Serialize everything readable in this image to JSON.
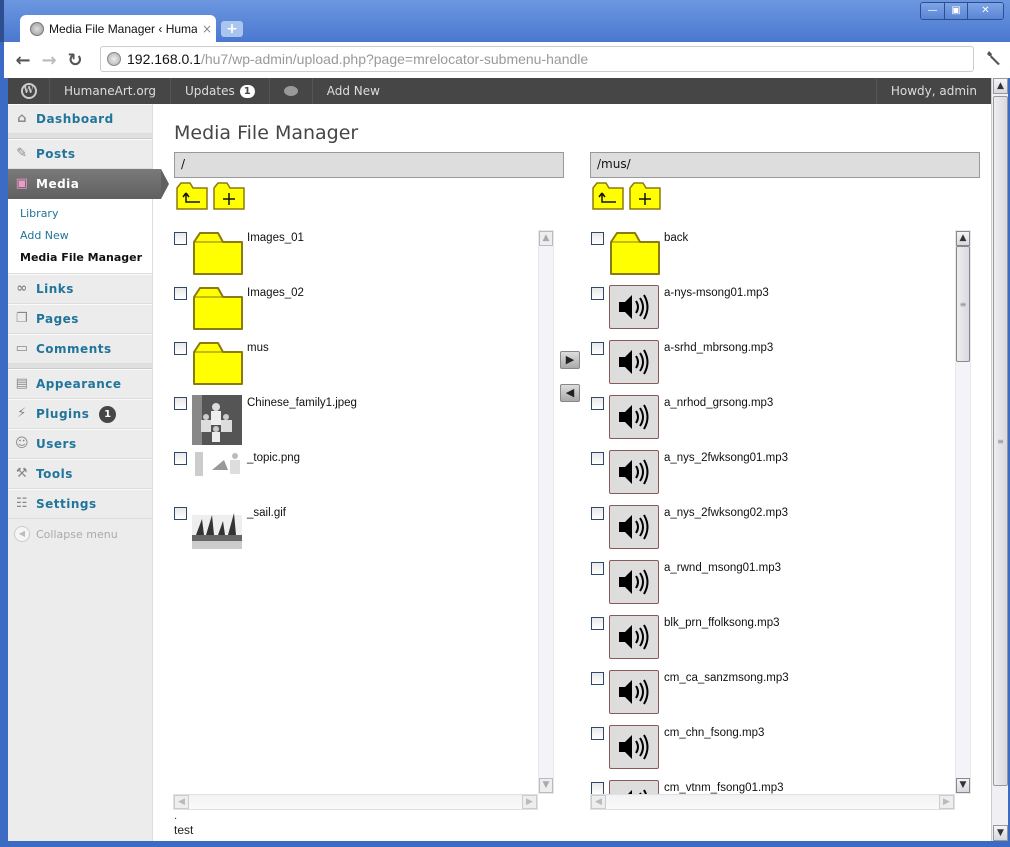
{
  "browser": {
    "tab_title": "Media File Manager ‹ Humai",
    "tab_close": "×",
    "new_tab": "+",
    "url_host": "192.168.0.1",
    "url_path": "/hu7/wp-admin/upload.php?page=mrelocator-submenu-handle",
    "window_buttons": {
      "minimize": "—",
      "maximize": "▣",
      "close": "✕"
    },
    "nav": {
      "back": "←",
      "forward": "→",
      "reload": "↻"
    },
    "wrench": "🔧"
  },
  "admin_bar": {
    "site_name": "HumaneArt.org",
    "updates_label": "Updates",
    "updates_count": "1",
    "add_new": "Add New",
    "howdy": "Howdy, admin"
  },
  "sidebar": {
    "items": [
      {
        "label": "Dashboard",
        "icon": "⌂"
      },
      {
        "label": "Posts",
        "icon": "✎"
      },
      {
        "label": "Media",
        "icon": "▣"
      },
      {
        "label": "Links",
        "icon": "∞"
      },
      {
        "label": "Pages",
        "icon": "❐"
      },
      {
        "label": "Comments",
        "icon": "▭"
      },
      {
        "label": "Appearance",
        "icon": "▤"
      },
      {
        "label": "Plugins",
        "icon": "⚡",
        "badge": "1"
      },
      {
        "label": "Users",
        "icon": "☺"
      },
      {
        "label": "Tools",
        "icon": "⚒"
      },
      {
        "label": "Settings",
        "icon": "☷"
      }
    ],
    "media_submenu": [
      "Library",
      "Add New",
      "Media File Manager"
    ],
    "collapse": "Collapse menu"
  },
  "main": {
    "title": "Media File Manager",
    "left": {
      "path": "/",
      "items": [
        {
          "name": "Images_01",
          "type": "folder"
        },
        {
          "name": "Images_02",
          "type": "folder"
        },
        {
          "name": "mus",
          "type": "folder"
        },
        {
          "name": "Chinese_family1.jpeg",
          "type": "photo"
        },
        {
          "name": "_topic.png",
          "type": "photo-light"
        },
        {
          "name": "_sail.gif",
          "type": "photo-sail"
        }
      ]
    },
    "right": {
      "path": "/mus/",
      "items": [
        {
          "name": "back",
          "type": "folder"
        },
        {
          "name": "a-nys-msong01.mp3",
          "type": "audio"
        },
        {
          "name": "a-srhd_mbrsong.mp3",
          "type": "audio"
        },
        {
          "name": "a_nrhod_grsong.mp3",
          "type": "audio"
        },
        {
          "name": "a_nys_2fwksong01.mp3",
          "type": "audio"
        },
        {
          "name": "a_nys_2fwksong02.mp3",
          "type": "audio"
        },
        {
          "name": "a_rwnd_msong01.mp3",
          "type": "audio"
        },
        {
          "name": "blk_prn_ffolksong.mp3",
          "type": "audio"
        },
        {
          "name": "cm_ca_sanzmsong.mp3",
          "type": "audio"
        },
        {
          "name": "cm_chn_fsong.mp3",
          "type": "audio"
        },
        {
          "name": "cm_vtnm_fsong01.mp3",
          "type": "audio"
        }
      ]
    },
    "move_right": "▶",
    "move_left": "◀",
    "footer_dot": ".",
    "footer_text": "test"
  },
  "colors": {
    "folder_fill": "#ffff00",
    "folder_stroke": "#8a7a10",
    "wp_link": "#21759b",
    "admin_bar": "#464646"
  }
}
